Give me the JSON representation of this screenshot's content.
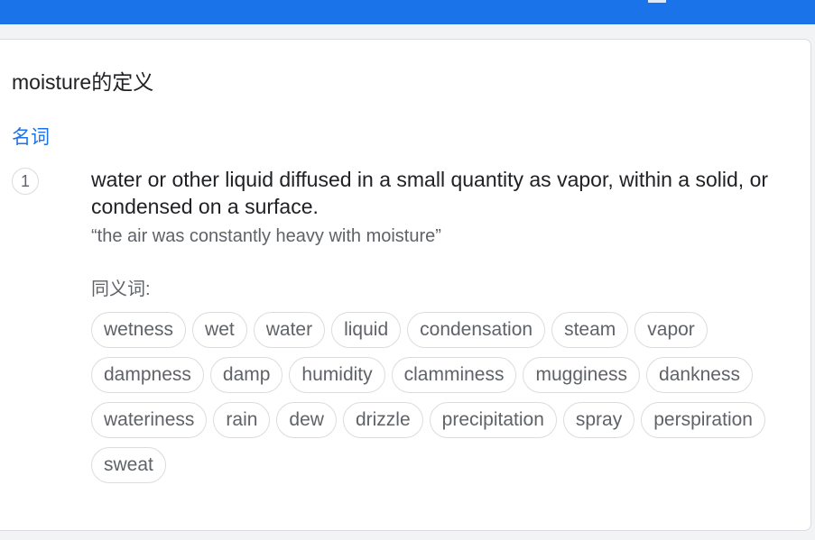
{
  "definition_card": {
    "title": "moisture的定义",
    "part_of_speech": "名词",
    "sense_number": "1",
    "definition": "water or other liquid diffused in a small quantity as vapor, within a solid, or condensed on a surface.",
    "example": "“the air was constantly heavy with moisture”",
    "synonyms_label": "同义词:",
    "synonyms": [
      "wetness",
      "wet",
      "water",
      "liquid",
      "condensation",
      "steam",
      "vapor",
      "dampness",
      "damp",
      "humidity",
      "clamminess",
      "mugginess",
      "dankness",
      "wateriness",
      "rain",
      "dew",
      "drizzle",
      "precipitation",
      "spray",
      "perspiration",
      "sweat"
    ]
  },
  "colors": {
    "topbar": "#1a73e8",
    "accent": "#1a73e8",
    "text": "#202124",
    "muted": "#5f6368",
    "border": "#dadce0"
  }
}
